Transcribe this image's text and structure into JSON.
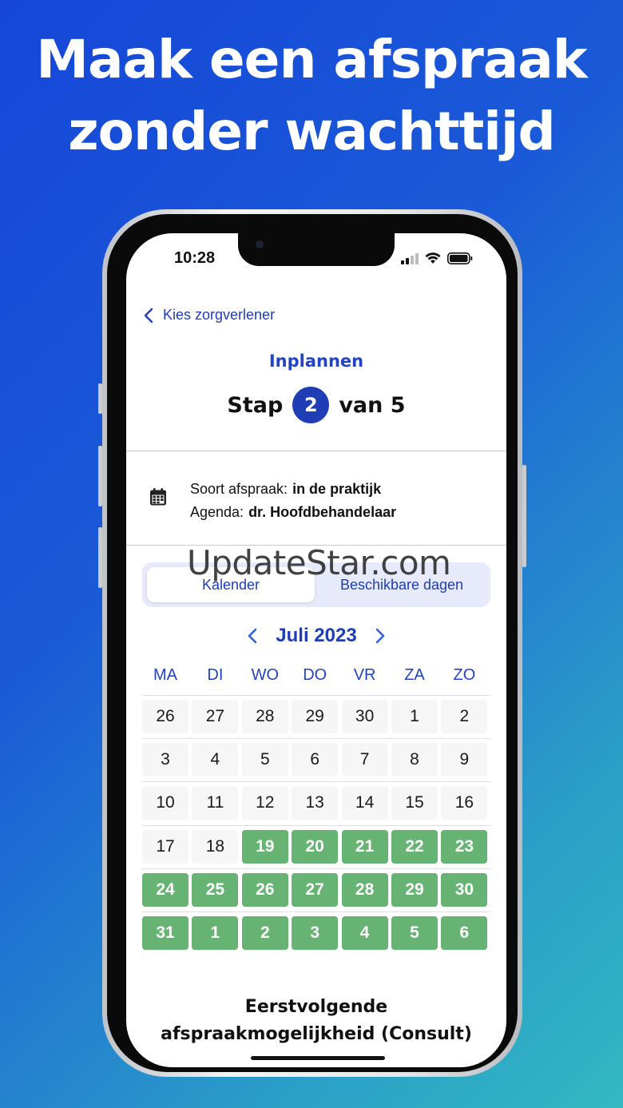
{
  "headline": {
    "line1": "Maak een afspraak",
    "line2": "zonder wachttijd"
  },
  "status_bar": {
    "time": "10:28"
  },
  "nav": {
    "back_label": "Kies zorgverlener"
  },
  "header": {
    "title": "Inplannen",
    "step_prefix": "Stap",
    "step_number": "2",
    "step_suffix": "van 5"
  },
  "info": {
    "type_label": "Soort afspraak:",
    "type_value": "in de praktijk",
    "agenda_label": "Agenda:",
    "agenda_value": "dr. Hoofdbehandelaar"
  },
  "tabs": {
    "calendar": "Kalender",
    "available_days": "Beschikbare dagen",
    "selected": "Kalender"
  },
  "watermark": "UpdateStar.com",
  "calendar": {
    "month": "Juli 2023",
    "weekdays": [
      "MA",
      "DI",
      "WO",
      "DO",
      "VR",
      "ZA",
      "ZO"
    ],
    "weeks": [
      [
        {
          "d": "26",
          "a": false
        },
        {
          "d": "27",
          "a": false
        },
        {
          "d": "28",
          "a": false
        },
        {
          "d": "29",
          "a": false
        },
        {
          "d": "30",
          "a": false
        },
        {
          "d": "1",
          "a": false
        },
        {
          "d": "2",
          "a": false
        }
      ],
      [
        {
          "d": "3",
          "a": false
        },
        {
          "d": "4",
          "a": false
        },
        {
          "d": "5",
          "a": false
        },
        {
          "d": "6",
          "a": false
        },
        {
          "d": "7",
          "a": false
        },
        {
          "d": "8",
          "a": false
        },
        {
          "d": "9",
          "a": false
        }
      ],
      [
        {
          "d": "10",
          "a": false
        },
        {
          "d": "11",
          "a": false
        },
        {
          "d": "12",
          "a": false
        },
        {
          "d": "13",
          "a": false
        },
        {
          "d": "14",
          "a": false
        },
        {
          "d": "15",
          "a": false
        },
        {
          "d": "16",
          "a": false
        }
      ],
      [
        {
          "d": "17",
          "a": false
        },
        {
          "d": "18",
          "a": false
        },
        {
          "d": "19",
          "a": true
        },
        {
          "d": "20",
          "a": true
        },
        {
          "d": "21",
          "a": true
        },
        {
          "d": "22",
          "a": true
        },
        {
          "d": "23",
          "a": true
        }
      ],
      [
        {
          "d": "24",
          "a": true
        },
        {
          "d": "25",
          "a": true
        },
        {
          "d": "26",
          "a": true
        },
        {
          "d": "27",
          "a": true
        },
        {
          "d": "28",
          "a": true
        },
        {
          "d": "29",
          "a": true
        },
        {
          "d": "30",
          "a": true
        }
      ],
      [
        {
          "d": "31",
          "a": true
        },
        {
          "d": "1",
          "a": true
        },
        {
          "d": "2",
          "a": true
        },
        {
          "d": "3",
          "a": true
        },
        {
          "d": "4",
          "a": true
        },
        {
          "d": "5",
          "a": true
        },
        {
          "d": "6",
          "a": true
        }
      ]
    ]
  },
  "next_available": {
    "line1": "Eerstvolgende",
    "line2": "afspraakmogelijkheid (Consult)"
  },
  "colors": {
    "accent": "#1f3db5",
    "available": "#67b374",
    "background_start": "#1546d8",
    "background_end": "#33b8c2"
  }
}
